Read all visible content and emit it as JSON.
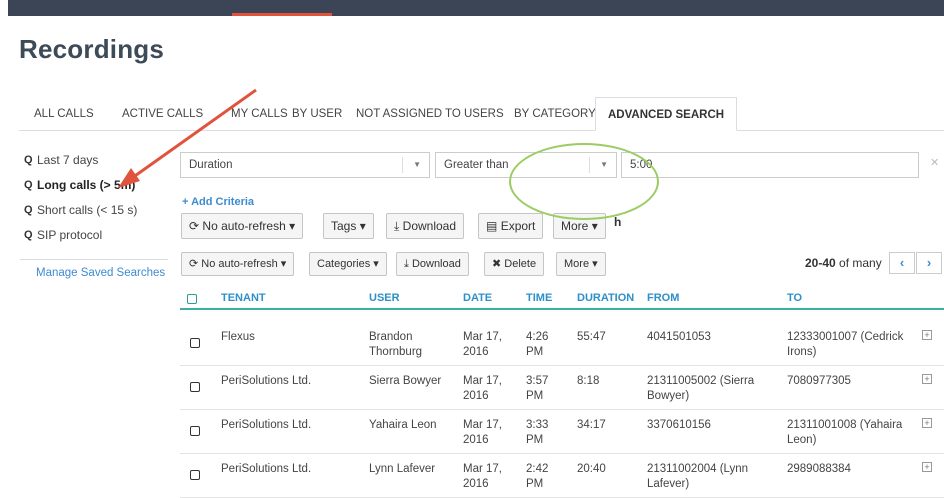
{
  "page": {
    "title": "Recordings"
  },
  "tabs": [
    {
      "label": "ALL CALLS"
    },
    {
      "label": "ACTIVE CALLS"
    },
    {
      "label": "MY CALLS"
    },
    {
      "label": "BY USER"
    },
    {
      "label": "NOT ASSIGNED TO USERS"
    },
    {
      "label": "BY CATEGORY"
    },
    {
      "label": "ADVANCED SEARCH"
    }
  ],
  "sidebar": {
    "items": [
      {
        "label": "Last 7 days"
      },
      {
        "label": "Long calls (> 5m)"
      },
      {
        "label": "Short calls (< 15 s)"
      },
      {
        "label": "SIP protocol"
      }
    ],
    "manage_label": "Manage Saved Searches"
  },
  "criteria": {
    "field": "Duration",
    "operator": "Greater than",
    "value": "5:00",
    "add_label": "+ Add Criteria"
  },
  "toolbar_upper": {
    "autorefresh": "No auto-refresh",
    "tags": "Tags",
    "download": "Download",
    "export": "Export",
    "more": "More",
    "trailing": "h"
  },
  "toolbar": {
    "autorefresh": "No auto-refresh",
    "categories": "Categories",
    "download": "Download",
    "delete": "Delete",
    "more": "More"
  },
  "pagination": {
    "range": "20-40",
    "of_label": "of many"
  },
  "table": {
    "headers": [
      "TENANT",
      "USER",
      "DATE",
      "TIME",
      "DURATION",
      "FROM",
      "TO"
    ],
    "rows": [
      {
        "tenant": "Flexus",
        "user": "Brandon Thornburg",
        "date": "Mar 17, 2016",
        "time": "4:26 PM",
        "duration": "55:47",
        "from": "4041501053",
        "to": "12333001007 (Cedrick Irons)"
      },
      {
        "tenant": "PeriSolutions Ltd.",
        "user": "Sierra Bowyer",
        "date": "Mar 17, 2016",
        "time": "3:57 PM",
        "duration": "8:18",
        "from": "21311005002 (Sierra Bowyer)",
        "to": "7080977305"
      },
      {
        "tenant": "PeriSolutions Ltd.",
        "user": "Yahaira Leon",
        "date": "Mar 17, 2016",
        "time": "3:33 PM",
        "duration": "34:17",
        "from": "3370610156",
        "to": "21311001008 (Yahaira Leon)"
      },
      {
        "tenant": "PeriSolutions Ltd.",
        "user": "Lynn Lafever",
        "date": "Mar 17, 2016",
        "time": "2:42 PM",
        "duration": "20:40",
        "from": "21311002004 (Lynn Lafever)",
        "to": "2989088384"
      }
    ]
  },
  "colors": {
    "accent_link": "#3d8bd0",
    "header_text": "#2e8fc9",
    "header_rule": "#3ab0a0",
    "annotation_arrow": "#e0533d",
    "annotation_ellipse": "#9ccc63"
  }
}
